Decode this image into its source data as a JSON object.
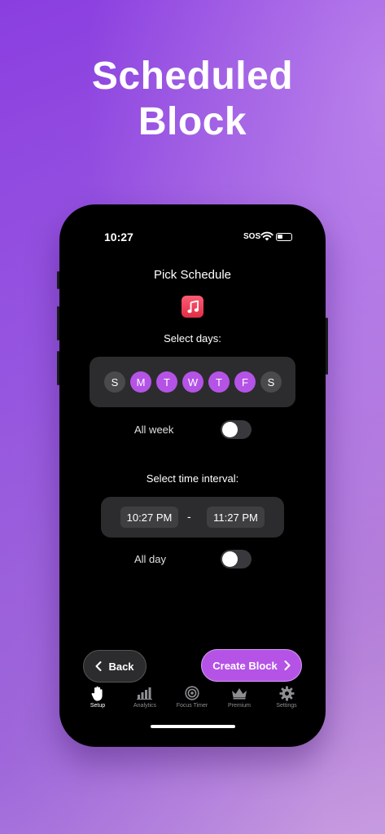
{
  "headline": {
    "line1": "Scheduled",
    "line2": "Block"
  },
  "status_bar": {
    "time": "10:27",
    "carrier": "SOS"
  },
  "screen": {
    "title": "Pick Schedule",
    "app_icon": "music-app-icon",
    "select_days_label": "Select days:",
    "days": [
      {
        "letter": "S",
        "selected": false
      },
      {
        "letter": "M",
        "selected": true
      },
      {
        "letter": "T",
        "selected": true
      },
      {
        "letter": "W",
        "selected": true
      },
      {
        "letter": "T",
        "selected": true
      },
      {
        "letter": "F",
        "selected": true
      },
      {
        "letter": "S",
        "selected": false
      }
    ],
    "all_week_label": "All week",
    "all_week_on": false,
    "select_time_label": "Select time interval:",
    "start_time": "10:27 PM",
    "separator": "-",
    "end_time": "11:27 PM",
    "all_day_label": "All day",
    "all_day_on": false,
    "back_label": "Back",
    "create_label": "Create Block"
  },
  "tabs": [
    {
      "label": "Setup",
      "icon": "hand-icon",
      "active": true
    },
    {
      "label": "Analytics",
      "icon": "bar-chart-icon",
      "active": false
    },
    {
      "label": "Focus Timer",
      "icon": "target-icon",
      "active": false
    },
    {
      "label": "Premium",
      "icon": "crown-icon",
      "active": false
    },
    {
      "label": "Settings",
      "icon": "gear-icon",
      "active": false
    }
  ],
  "colors": {
    "accent": "#b553e6",
    "background_start": "#8a3ee0",
    "background_end": "#c79be0",
    "panel": "#2c2c2e"
  }
}
